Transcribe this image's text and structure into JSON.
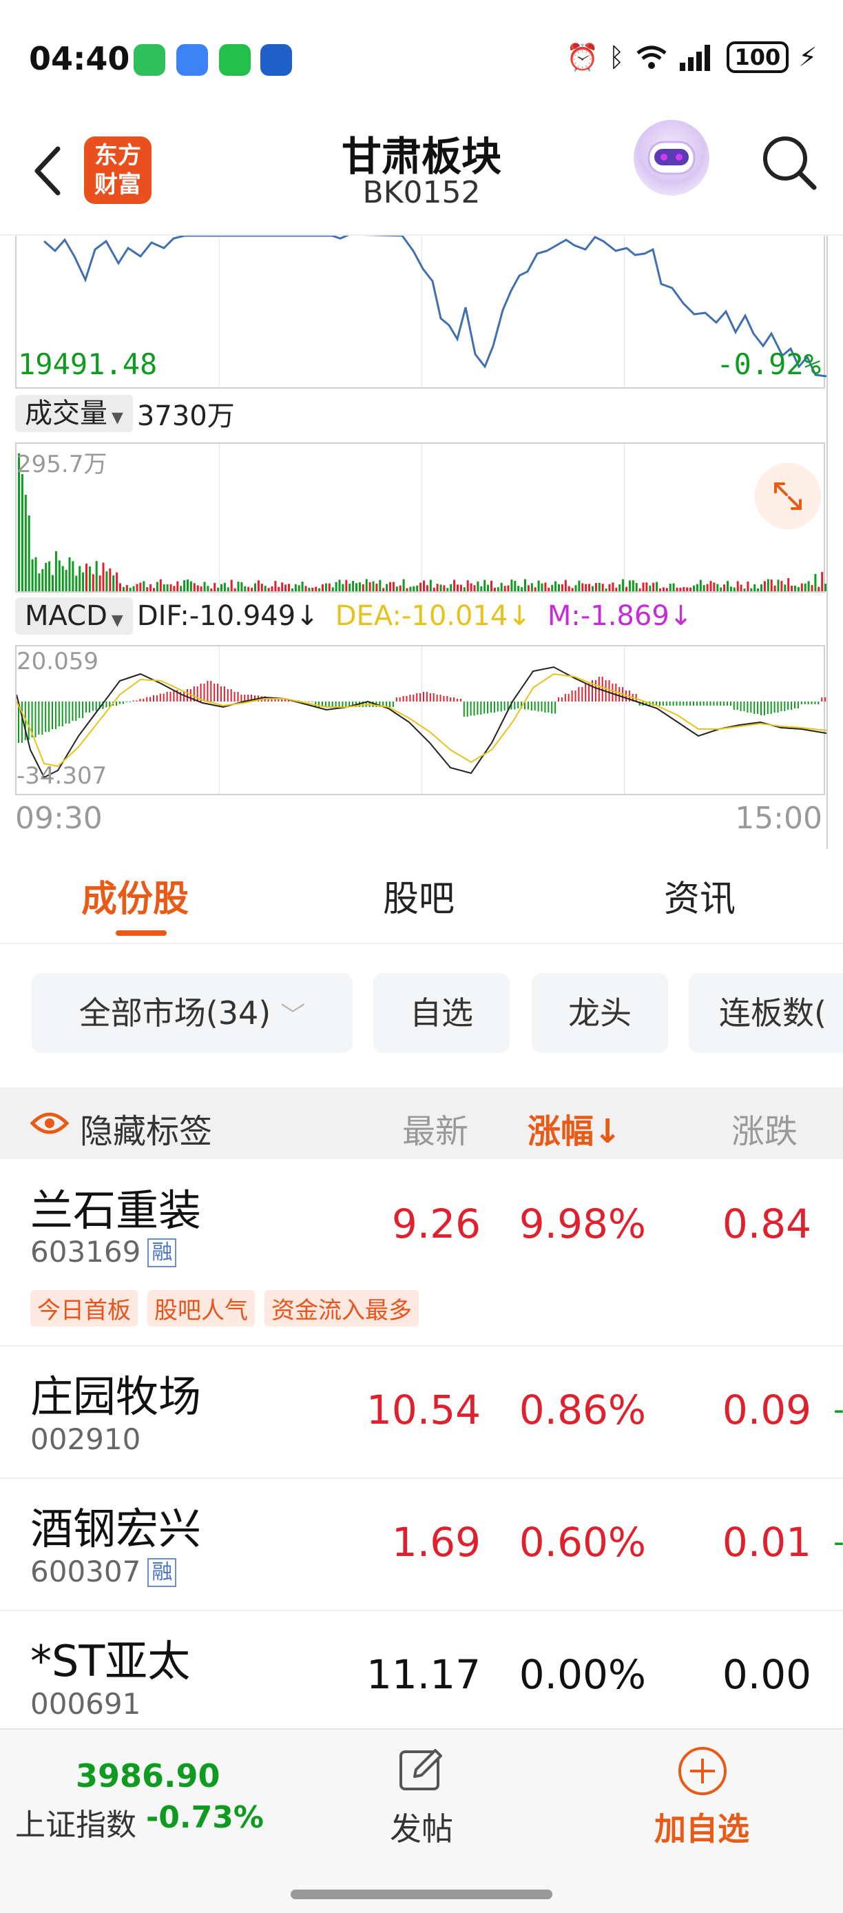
{
  "status_bar": {
    "time": "04:40",
    "battery": "100",
    "apps": [
      "green-app-icon",
      "message-app-icon",
      "wechat-icon",
      "bank-app-icon"
    ],
    "indicators": [
      "alarm-icon",
      "bluetooth-icon",
      "wifi-icon",
      "signal-icon",
      "charging-icon"
    ]
  },
  "header": {
    "title": "甘肃板块",
    "code": "BK0152",
    "logo_text_line1": "东方",
    "logo_text_line2": "财富"
  },
  "chart": {
    "price_low": "19491.48",
    "pct_low": "-0.92%",
    "volume_selector": "成交量",
    "volume_total": "3730万",
    "volume_max_label": "295.7万",
    "macd_selector": "MACD",
    "dif": "DIF:-10.949↓",
    "dea": "DEA:-10.014↓",
    "m": "M:-1.869↓",
    "macd_top": "20.059",
    "macd_bottom": "-34.307",
    "time_start": "09:30",
    "time_end": "15:00",
    "colors": {
      "price_line": "#3f6fb0",
      "up": "#e0202c",
      "down": "#0f9b1f",
      "dea_line": "#e6c21a",
      "m_text": "#c62bd9"
    }
  },
  "tabs": [
    {
      "label": "成份股",
      "active": true
    },
    {
      "label": "股吧",
      "active": false
    },
    {
      "label": "资讯",
      "active": false
    }
  ],
  "filters": [
    "全部市场(34)",
    "自选",
    "龙头",
    "连板数("
  ],
  "table": {
    "hide_tags_label": "隐藏标签",
    "columns": [
      "最新",
      "涨幅↓",
      "涨跌"
    ],
    "rows": [
      {
        "name": "兰石重装",
        "code": "603169",
        "rong": "融",
        "price": "9.26",
        "pct": "9.98%",
        "chg": "0.84",
        "tags": [
          "今日首板",
          "股吧人气",
          "资金流入最多"
        ]
      },
      {
        "name": "庄园牧场",
        "code": "002910",
        "rong": "",
        "price": "10.54",
        "pct": "0.86%",
        "chg": "0.09",
        "tags": []
      },
      {
        "name": "酒钢宏兴",
        "code": "600307",
        "rong": "融",
        "price": "1.69",
        "pct": "0.60%",
        "chg": "0.01",
        "tags": []
      },
      {
        "name": "*ST亚太",
        "code": "000691",
        "rong": "",
        "price": "11.17",
        "pct": "0.00%",
        "chg": "0.00",
        "tags": []
      }
    ]
  },
  "bottom_bar": {
    "index_value": "3986.90",
    "index_name": "上证指数",
    "index_change": "-0.73%",
    "post_label": "发帖",
    "add_label": "加自选"
  }
}
